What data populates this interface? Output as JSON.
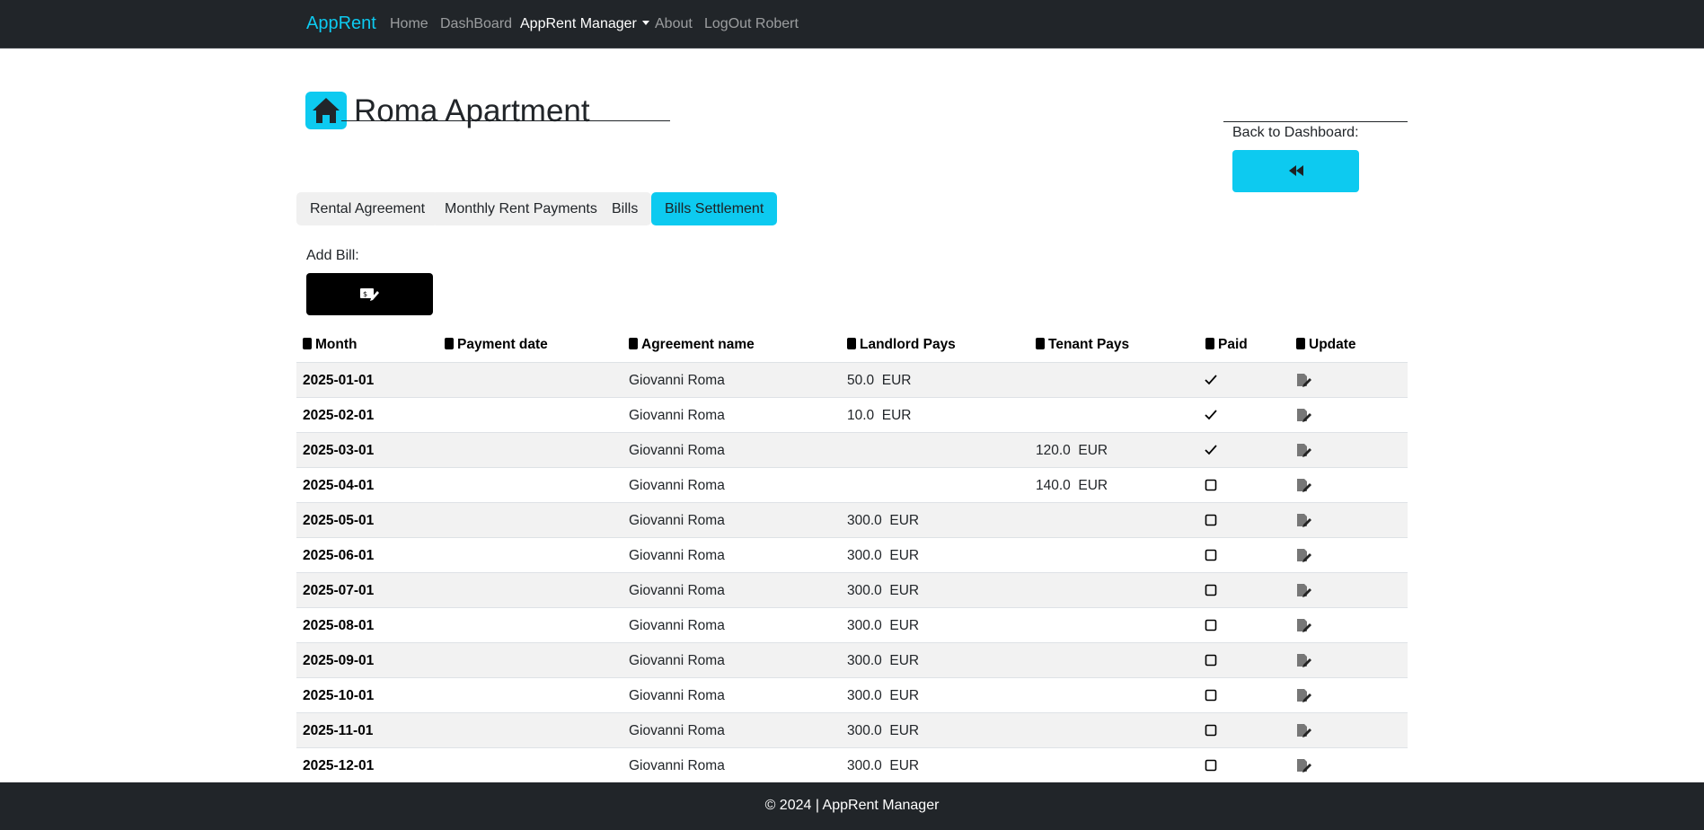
{
  "nav": {
    "brand": "AppRent",
    "links": [
      "Home",
      "DashBoard",
      "AppRent Manager",
      "About",
      "LogOut Robert"
    ]
  },
  "page": {
    "title": "Roma Apartment",
    "icon": "home-icon",
    "back_label": "Back to Dashboard:",
    "back_icon": "rewind-icon",
    "add_label": "Add Bill:",
    "add_icon": "bill-edit-icon"
  },
  "tabs": [
    "Rental Agreement",
    "Monthly Rent Payments",
    "Bills",
    "Bills Settlement"
  ],
  "active_tab": "Bills Settlement",
  "table": {
    "headers": [
      "Month",
      "Payment date",
      "Agreement name",
      "Landlord Pays",
      "Tenant Pays",
      "Paid",
      "Update"
    ],
    "rows": [
      {
        "month": "2025-01-01",
        "payment_date": "",
        "agreement": "Giovanni Roma",
        "landlord": "50.0  EUR",
        "tenant": "",
        "paid": true
      },
      {
        "month": "2025-02-01",
        "payment_date": "",
        "agreement": "Giovanni Roma",
        "landlord": "10.0  EUR",
        "tenant": "",
        "paid": true
      },
      {
        "month": "2025-03-01",
        "payment_date": "",
        "agreement": "Giovanni Roma",
        "landlord": "",
        "tenant": "120.0  EUR",
        "paid": true
      },
      {
        "month": "2025-04-01",
        "payment_date": "",
        "agreement": "Giovanni Roma",
        "landlord": "",
        "tenant": "140.0  EUR",
        "paid": false
      },
      {
        "month": "2025-05-01",
        "payment_date": "",
        "agreement": "Giovanni Roma",
        "landlord": "300.0  EUR",
        "tenant": "",
        "paid": false
      },
      {
        "month": "2025-06-01",
        "payment_date": "",
        "agreement": "Giovanni Roma",
        "landlord": "300.0  EUR",
        "tenant": "",
        "paid": false
      },
      {
        "month": "2025-07-01",
        "payment_date": "",
        "agreement": "Giovanni Roma",
        "landlord": "300.0  EUR",
        "tenant": "",
        "paid": false
      },
      {
        "month": "2025-08-01",
        "payment_date": "",
        "agreement": "Giovanni Roma",
        "landlord": "300.0  EUR",
        "tenant": "",
        "paid": false
      },
      {
        "month": "2025-09-01",
        "payment_date": "",
        "agreement": "Giovanni Roma",
        "landlord": "300.0  EUR",
        "tenant": "",
        "paid": false
      },
      {
        "month": "2025-10-01",
        "payment_date": "",
        "agreement": "Giovanni Roma",
        "landlord": "300.0  EUR",
        "tenant": "",
        "paid": false
      },
      {
        "month": "2025-11-01",
        "payment_date": "",
        "agreement": "Giovanni Roma",
        "landlord": "300.0  EUR",
        "tenant": "",
        "paid": false
      },
      {
        "month": "2025-12-01",
        "payment_date": "",
        "agreement": "Giovanni Roma",
        "landlord": "300.0  EUR",
        "tenant": "",
        "paid": false
      }
    ]
  },
  "footer": {
    "text": "© 2024 | AppRent Manager"
  },
  "colors": {
    "accent": "#0dcaf0",
    "navbar": "#212529",
    "add_button": "#000000"
  }
}
